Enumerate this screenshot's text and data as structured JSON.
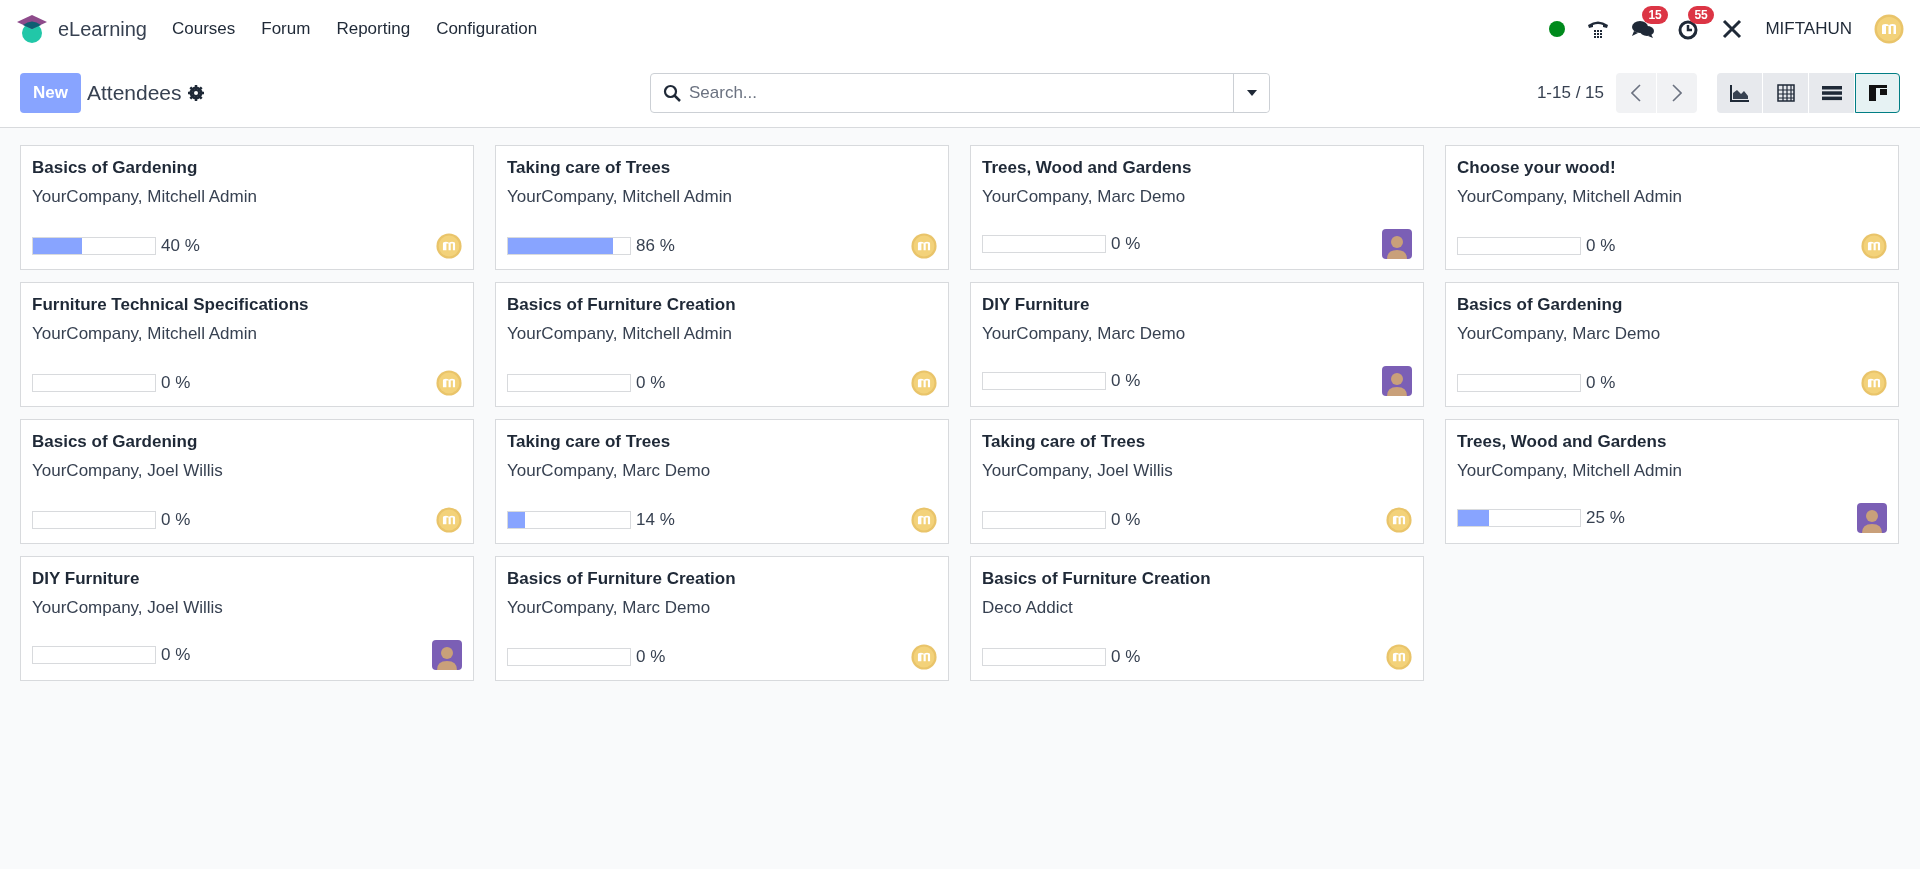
{
  "navbar": {
    "app_name": "eLearning",
    "menu": [
      "Courses",
      "Forum",
      "Reporting",
      "Configuration"
    ],
    "messages_badge": "15",
    "activities_badge": "55",
    "user_name": "MIFTAHUN"
  },
  "control_panel": {
    "new_button": "New",
    "title": "Attendees",
    "search": {
      "placeholder": "Search..."
    },
    "pager": "1-15 / 15",
    "views": [
      {
        "kind": "graph",
        "selected": false
      },
      {
        "kind": "pivot",
        "selected": false
      },
      {
        "kind": "list",
        "selected": false
      },
      {
        "kind": "kanban",
        "selected": true
      }
    ]
  },
  "cards": [
    {
      "title": "Basics of Gardening",
      "subtitle": "YourCompany, Mitchell Admin",
      "level": 0.4,
      "reading": "40 %",
      "kind": "coin"
    },
    {
      "title": "Taking care of Trees",
      "subtitle": "YourCompany, Mitchell Admin",
      "level": 0.86,
      "reading": "86 %",
      "kind": "coin"
    },
    {
      "title": "Trees, Wood and Gardens",
      "subtitle": "YourCompany, Marc Demo",
      "level": 0,
      "reading": "0 %",
      "kind": "portrait"
    },
    {
      "title": "Choose your wood!",
      "subtitle": "YourCompany, Mitchell Admin",
      "level": 0,
      "reading": "0 %",
      "kind": "coin"
    },
    {
      "title": "Furniture Technical Specifications",
      "subtitle": "YourCompany, Mitchell Admin",
      "level": 0,
      "reading": "0 %",
      "kind": "coin"
    },
    {
      "title": "Basics of Furniture Creation",
      "subtitle": "YourCompany, Mitchell Admin",
      "level": 0,
      "reading": "0 %",
      "kind": "coin"
    },
    {
      "title": "DIY Furniture",
      "subtitle": "YourCompany, Marc Demo",
      "level": 0,
      "reading": "0 %",
      "kind": "portrait"
    },
    {
      "title": "Basics of Gardening",
      "subtitle": "YourCompany, Marc Demo",
      "level": 0,
      "reading": "0 %",
      "kind": "coin"
    },
    {
      "title": "Basics of Gardening",
      "subtitle": "YourCompany, Joel Willis",
      "level": 0,
      "reading": "0 %",
      "kind": "coin"
    },
    {
      "title": "Taking care of Trees",
      "subtitle": "YourCompany, Marc Demo",
      "level": 0.14,
      "reading": "14 %",
      "kind": "coin"
    },
    {
      "title": "Taking care of Trees",
      "subtitle": "YourCompany, Joel Willis",
      "level": 0,
      "reading": "0 %",
      "kind": "coin"
    },
    {
      "title": "Trees, Wood and Gardens",
      "subtitle": "YourCompany, Mitchell Admin",
      "level": 0.25,
      "reading": "25 %",
      "kind": "portrait"
    },
    {
      "title": "DIY Furniture",
      "subtitle": "YourCompany, Joel Willis",
      "level": 0,
      "reading": "0 %",
      "kind": "portrait"
    },
    {
      "title": "Basics of Furniture Creation",
      "subtitle": "YourCompany, Marc Demo",
      "level": 0,
      "reading": "0 %",
      "kind": "coin"
    },
    {
      "title": "Basics of Furniture Creation",
      "subtitle": "Deco Addict",
      "level": 0,
      "reading": "0 %",
      "kind": "coin"
    }
  ]
}
